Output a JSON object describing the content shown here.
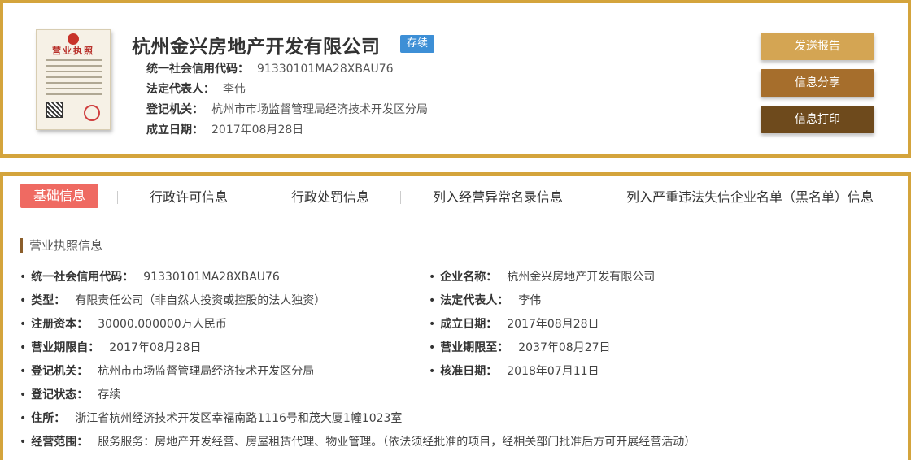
{
  "header": {
    "license_image_title": "营业执照",
    "company_name": "杭州金兴房地产开发有限公司",
    "status_badge": "存续",
    "credit_code_label": "统一社会信用代码：",
    "credit_code": "91330101MA28XBAU76",
    "legal_rep_label": "法定代表人：",
    "legal_rep": "李伟",
    "registry_label": "登记机关：",
    "registry": "杭州市市场监督管理局经济技术开发区分局",
    "founded_label": "成立日期：",
    "founded": "2017年08月28日"
  },
  "actions": {
    "send_report": "发送报告",
    "share_info": "信息分享",
    "print_info": "信息打印"
  },
  "tabs": [
    {
      "label": "基础信息"
    },
    {
      "label": "行政许可信息"
    },
    {
      "label": "行政处罚信息"
    },
    {
      "label": "列入经营异常名录信息"
    },
    {
      "label": "列入严重违法失信企业名单（黑名单）信息"
    }
  ],
  "detail": {
    "section_title": "营业执照信息",
    "fields": [
      {
        "label": "统一社会信用代码：",
        "value": "91330101MA28XBAU76"
      },
      {
        "label": "企业名称：",
        "value": "杭州金兴房地产开发有限公司"
      },
      {
        "label": "类型：",
        "value": "有限责任公司（非自然人投资或控股的法人独资）"
      },
      {
        "label": "法定代表人：",
        "value": "李伟"
      },
      {
        "label": "注册资本：",
        "value": "30000.000000万人民币"
      },
      {
        "label": "成立日期：",
        "value": "2017年08月28日"
      },
      {
        "label": "营业期限自：",
        "value": "2017年08月28日"
      },
      {
        "label": "营业期限至：",
        "value": "2037年08月27日"
      },
      {
        "label": "登记机关：",
        "value": "杭州市市场监督管理局经济技术开发区分局"
      },
      {
        "label": "核准日期：",
        "value": "2018年07月11日"
      },
      {
        "label": "登记状态：",
        "value": "存续"
      },
      {
        "label": "住所：",
        "value": "浙江省杭州经济技术开发区幸福南路1116号和茂大厦1幢1023室"
      },
      {
        "label": "经营范围：",
        "value": "服务服务：房地产开发经营、房屋租赁代理、物业管理。（依法须经批准的项目，经相关部门批准后方可开展经营活动）"
      }
    ]
  },
  "colors": {
    "gold_border": "#d4a43c",
    "badge_blue": "#3d8fd6",
    "tab_active": "#ef6a62",
    "btn_report": "#d4a553",
    "btn_share": "#a66e2c",
    "btn_print": "#6e4a1c"
  }
}
